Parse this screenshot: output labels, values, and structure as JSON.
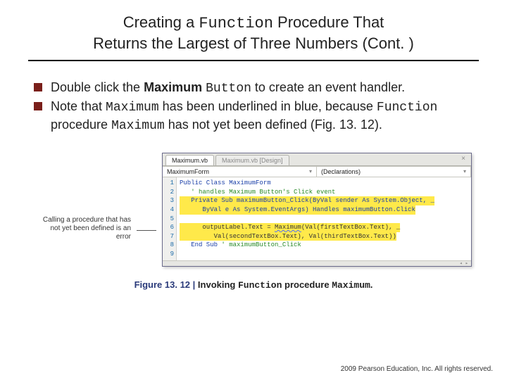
{
  "title": {
    "line1_pre": "Creating a ",
    "line1_mono": "Function",
    "line1_post": " Procedure That",
    "line2": "Returns the Largest of Three Numbers (Cont. )"
  },
  "bullets": {
    "b1": {
      "t1": "Double click the ",
      "t2_bold": "Maximum ",
      "t3_mono": "Button",
      "t4": " to create an event handler."
    },
    "b2": {
      "t1": "Note that ",
      "t2_mono": "Maximum",
      "t3": " has been underlined in blue, because ",
      "t4_mono": "Function",
      "t5": " procedure ",
      "t6_mono": "Maximum",
      "t7": " has not yet been defined (Fig. 13. 12)."
    }
  },
  "annotation": "Calling a procedure that has not yet been defined is an error",
  "ide": {
    "tabs": {
      "active": "Maximum.vb",
      "inactive": "Maximum.vb [Design]"
    },
    "dropdowns": {
      "left": "MaximumForm",
      "right": "(Declarations)"
    },
    "gutter": [
      "1",
      "2",
      "3",
      "4",
      "5",
      "6",
      "7",
      "8",
      "9"
    ],
    "code": {
      "l1": "Public Class MaximumForm",
      "l2": "   ' handles Maximum Button's Click event",
      "l3a": "   Private Sub maximumButton_Click(ByVal sender As System.Object, _",
      "l4a": "      ByVal e As System.EventArgs) Handles maximumButton.Click",
      "l5": "",
      "l6a": "      outputLabel.Text = ",
      "l6b": "Maximum",
      "l6c": "(Val(firstTextBox.Text), _",
      "l7a": "         Val(secondTextBox.Text), Val(thirdTextBox.Text))",
      "l8a": "   End Sub",
      "l8b": " ' maximumButton_Click"
    }
  },
  "figcaption": {
    "lead": "Figure 13. 12 | ",
    "t1": "Invoking ",
    "t2_mono": "Function",
    "t3": " procedure ",
    "t4_mono": "Maximum",
    "t5": "."
  },
  "copyright": "  2009 Pearson Education, Inc. All rights reserved."
}
